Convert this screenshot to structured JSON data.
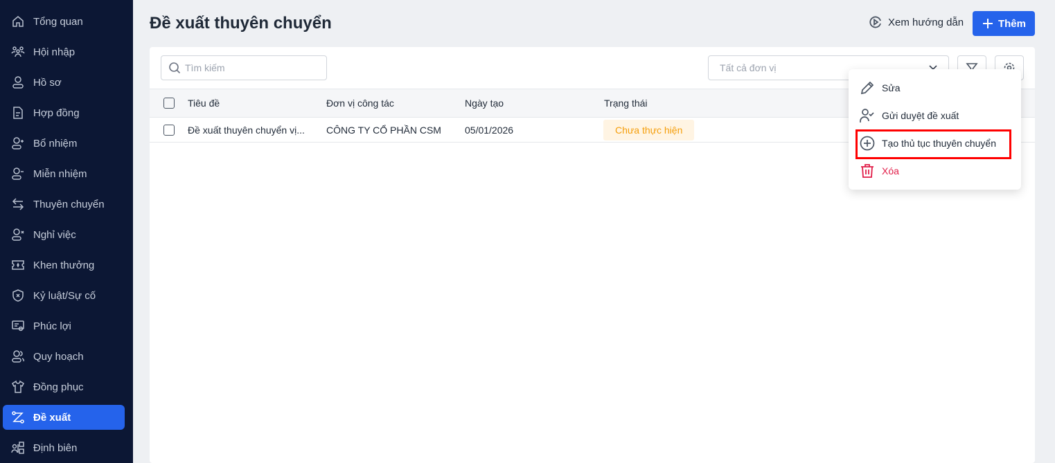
{
  "sidebar": {
    "items": [
      {
        "label": "Tổng quan",
        "icon": "home-icon"
      },
      {
        "label": "Hội nhập",
        "icon": "users-icon"
      },
      {
        "label": "Hồ sơ",
        "icon": "user-icon"
      },
      {
        "label": "Hợp đồng",
        "icon": "document-icon"
      },
      {
        "label": "Bổ nhiệm",
        "icon": "user-plus-icon"
      },
      {
        "label": "Miễn nhiệm",
        "icon": "user-minus-icon"
      },
      {
        "label": "Thuyên chuyển",
        "icon": "arrows-swap-icon"
      },
      {
        "label": "Nghỉ việc",
        "icon": "user-x-icon"
      },
      {
        "label": "Khen thưởng",
        "icon": "ticket-star-icon"
      },
      {
        "label": "Kỷ luật/Sự cố",
        "icon": "shield-x-icon"
      },
      {
        "label": "Phúc lợi",
        "icon": "certificate-icon"
      },
      {
        "label": "Quy hoạch",
        "icon": "user-group-icon"
      },
      {
        "label": "Đồng phục",
        "icon": "shirt-icon"
      },
      {
        "label": "Đề xuất",
        "icon": "route-icon",
        "active": true
      },
      {
        "label": "Định biên",
        "icon": "org-icon"
      }
    ]
  },
  "header": {
    "title": "Đề xuất thuyên chuyển",
    "guide_label": "Xem hướng dẫn",
    "add_label": "Thêm"
  },
  "toolbar": {
    "search_placeholder": "Tìm kiếm",
    "unit_select": "Tất cả đơn vị"
  },
  "table": {
    "columns": [
      "Tiêu đề",
      "Đơn vị công tác",
      "Ngày tạo",
      "Trạng thái"
    ],
    "rows": [
      {
        "title": "Đề xuất thuyên chuyển vị...",
        "unit": "CÔNG TY CỔ PHẦN CSM",
        "date": "05/01/2026",
        "status": "Chưa thực hiện"
      }
    ]
  },
  "menu": {
    "items": [
      {
        "label": "Sửa",
        "icon": "pencil-icon"
      },
      {
        "label": "Gửi duyệt đề xuất",
        "icon": "user-check-icon"
      },
      {
        "label": "Tạo thủ tục thuyên chuyển",
        "icon": "plus-circle-icon"
      },
      {
        "label": "Xóa",
        "icon": "trash-icon"
      }
    ]
  },
  "colors": {
    "accent": "#2563eb",
    "sidebar": "#0c1734",
    "status": "#f59e0b",
    "danger": "#e11d48",
    "highlight": "#ff0000"
  }
}
